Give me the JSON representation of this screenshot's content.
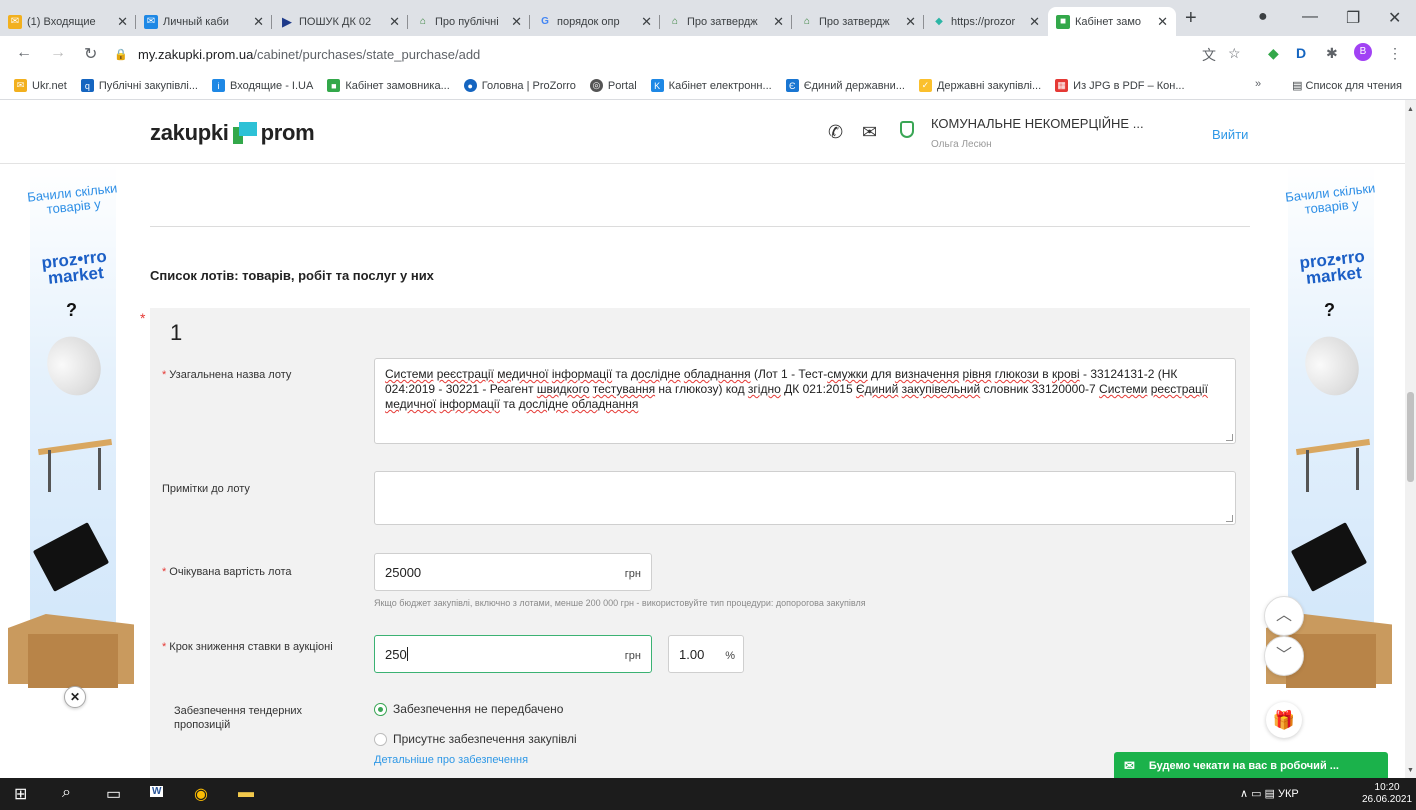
{
  "browser": {
    "tabs": [
      {
        "label": "(1) Входящие",
        "icon": "mail-icon",
        "color": "#f2b01e"
      },
      {
        "label": "Личный каби",
        "icon": "mail-icon",
        "color": "#1e88e5"
      },
      {
        "label": "ПОШУК ДК 02",
        "icon": "play-icon",
        "color": "#1e3a8a"
      },
      {
        "label": "Про публічні",
        "icon": "building-icon",
        "color": "#2e7d32"
      },
      {
        "label": "порядок опр",
        "icon": "google-icon",
        "color": "#4285f4"
      },
      {
        "label": "Про затвердж",
        "icon": "building-icon",
        "color": "#2e7d32"
      },
      {
        "label": "Про затвердж",
        "icon": "building-icon",
        "color": "#2e7d32"
      },
      {
        "label": "https://prozor",
        "icon": "prozorro-icon",
        "color": "#2bb5a5"
      },
      {
        "label": "Кабінет замо",
        "icon": "zakupki-icon",
        "color": "#33a84a",
        "active": true
      }
    ],
    "url_host": "my.zakupki.prom.ua",
    "url_path": "/cabinet/purchases/state_purchase/add",
    "avatar_letter": "B",
    "bookmarks": [
      {
        "label": "Ukr.net",
        "color": "#f2b01e"
      },
      {
        "label": "Публічні закупівлі...",
        "color": "#1565c0"
      },
      {
        "label": "Входящие - I.UA",
        "color": "#1e88e5"
      },
      {
        "label": "Кабінет замовника...",
        "color": "#33a84a"
      },
      {
        "label": "Головна | ProZorro",
        "color": "#1565c0"
      },
      {
        "label": "Portal",
        "color": "#555555"
      },
      {
        "label": "Кабінет електронн...",
        "color": "#1e88e5"
      },
      {
        "label": "Єдиний державни...",
        "color": "#1976d2"
      },
      {
        "label": "Державні закупівлі...",
        "color": "#fbc02d"
      },
      {
        "label": "Из JPG в PDF – Кон...",
        "color": "#e53935"
      }
    ],
    "more_bookmarks": "»",
    "reading_list": "Список для чтения"
  },
  "header": {
    "logo_left": "zakupki",
    "logo_right": "prom",
    "org_name": "КОМУНАЛЬНЕ НЕКОМЕРЦІЙНЕ ...",
    "user_name": "Ольга Лесюн",
    "logout": "Вийти"
  },
  "ad": {
    "line": "Бачили скільки товарів у",
    "brand_top": "proz•rro",
    "brand_bottom": "market",
    "question": "?"
  },
  "section_title": "Список лотів: товарів, робіт та послуг у них",
  "lot": {
    "number": "1",
    "name_label": "Узагальнена назва лоту",
    "name_value": [
      {
        "t": "Системи",
        "s": true
      },
      {
        "t": " ",
        "s": false
      },
      {
        "t": "реєстрації",
        "s": true
      },
      {
        "t": " ",
        "s": false
      },
      {
        "t": "медичної",
        "s": true
      },
      {
        "t": " ",
        "s": false
      },
      {
        "t": "інформації",
        "s": true
      },
      {
        "t": " та ",
        "s": false
      },
      {
        "t": "дослідне",
        "s": true
      },
      {
        "t": " ",
        "s": false
      },
      {
        "t": "обладнання",
        "s": true
      },
      {
        "t": "  (Лот 1 - Тест-",
        "s": false
      },
      {
        "t": "смужки",
        "s": true
      },
      {
        "t": " для ",
        "s": false
      },
      {
        "t": "визначення",
        "s": true
      },
      {
        "t": " ",
        "s": false
      },
      {
        "t": "рівня",
        "s": true
      },
      {
        "t": " ",
        "s": false
      },
      {
        "t": "глюкози",
        "s": true
      },
      {
        "t": " в ",
        "s": false
      },
      {
        "t": "крові",
        "s": true
      },
      {
        "t": " - 33124131-2 (НК 024:2019 - 30221 - Реагент ",
        "s": false
      },
      {
        "t": "швидкого",
        "s": true
      },
      {
        "t": " ",
        "s": false
      },
      {
        "t": "тестування",
        "s": true
      },
      {
        "t": " на глюкозу)  код ",
        "s": false
      },
      {
        "t": "згідно",
        "s": true
      },
      {
        "t": " ДК 021:2015 ",
        "s": false
      },
      {
        "t": "Єдиний",
        "s": true
      },
      {
        "t": " ",
        "s": false
      },
      {
        "t": "закупівельний",
        "s": true
      },
      {
        "t": " словник 33120000-7 ",
        "s": false
      },
      {
        "t": "Системи",
        "s": true
      },
      {
        "t": " ",
        "s": false
      },
      {
        "t": "реєстрації",
        "s": true
      },
      {
        "t": " ",
        "s": false
      },
      {
        "t": "медичної",
        "s": true
      },
      {
        "t": " ",
        "s": false
      },
      {
        "t": "інформації",
        "s": true
      },
      {
        "t": " та ",
        "s": false
      },
      {
        "t": "дослідне",
        "s": true
      },
      {
        "t": " ",
        "s": false
      },
      {
        "t": "обладнання",
        "s": true
      }
    ],
    "notes_label": "Примітки до лоту",
    "notes_value": "",
    "expected_label": "Очікувана вартість лота",
    "expected_value": "25000",
    "currency": "грн",
    "hint": "Якщо бюджет закупівлі, включно з лотами, менше 200 000 грн - використовуйте тип процедури: допорогова закупівля",
    "step_label": "Крок зниження ставки в аукціоні",
    "step_value": "250",
    "step_percent": "1.00",
    "percent_sign": "%",
    "security_label": "Забезпечення тендерних пропозицій",
    "security_options": [
      {
        "label": "Забезпечення не передбачено",
        "selected": true
      },
      {
        "label": "Присутнє забезпечення закупівлі",
        "selected": false
      }
    ],
    "security_link": "Детальніше про забезпечення"
  },
  "chat": {
    "label": "Будемо чекати на вас в робочий ..."
  },
  "taskbar": {
    "language": "УКР",
    "time": "10:20",
    "date": "26.06.2021"
  },
  "colors": {
    "accent_green": "#33a84a",
    "link_blue": "#2f98e6",
    "required_red": "#e53935"
  }
}
